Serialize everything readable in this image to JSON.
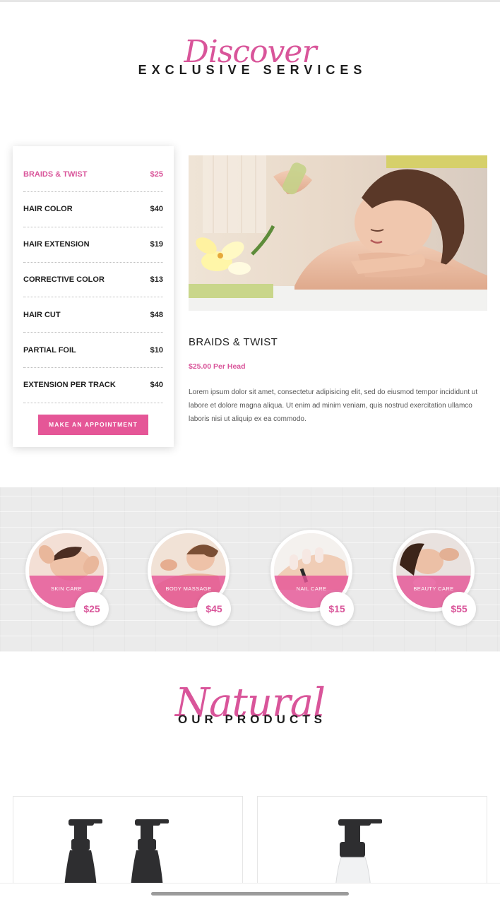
{
  "services_heading": {
    "script": "Discover",
    "title": "EXCLUSIVE SERVICES"
  },
  "menu": {
    "items": [
      {
        "name": "BRAIDS & TWIST",
        "price": "$25"
      },
      {
        "name": "HAIR COLOR",
        "price": "$40"
      },
      {
        "name": "HAIR EXTENSION",
        "price": "$19"
      },
      {
        "name": "CORRECTIVE COLOR",
        "price": "$13"
      },
      {
        "name": "HAIR CUT",
        "price": "$48"
      },
      {
        "name": "PARTIAL FOIL",
        "price": "$10"
      },
      {
        "name": "EXTENSION PER TRACK",
        "price": "$40"
      }
    ],
    "button_label": "MAKE AN APPOINTMENT"
  },
  "detail": {
    "title": "BRAIDS & TWIST",
    "price": "$25.00 Per Head",
    "description": "Lorem ipsum dolor sit amet, consectetur adipisicing elit, sed do eiusmod tempor incididunt ut labore et dolore magna aliqua. Ut enim ad minim veniam, quis nostrud exercitation ullamco laboris nisi ut aliquip ex ea commodo."
  },
  "service_tiles": [
    {
      "label": "SKIN CARE",
      "price": "$25"
    },
    {
      "label": "BODY MASSAGE",
      "price": "$45"
    },
    {
      "label": "NAIL CARE",
      "price": "$15"
    },
    {
      "label": "BEAUTY CARE",
      "price": "$55"
    }
  ],
  "products_heading": {
    "script": "Natural",
    "title": "OUR PRODUCTS"
  },
  "colors": {
    "accent": "#e55697",
    "text": "#1e1e1e",
    "strip": "#ebebeb"
  }
}
